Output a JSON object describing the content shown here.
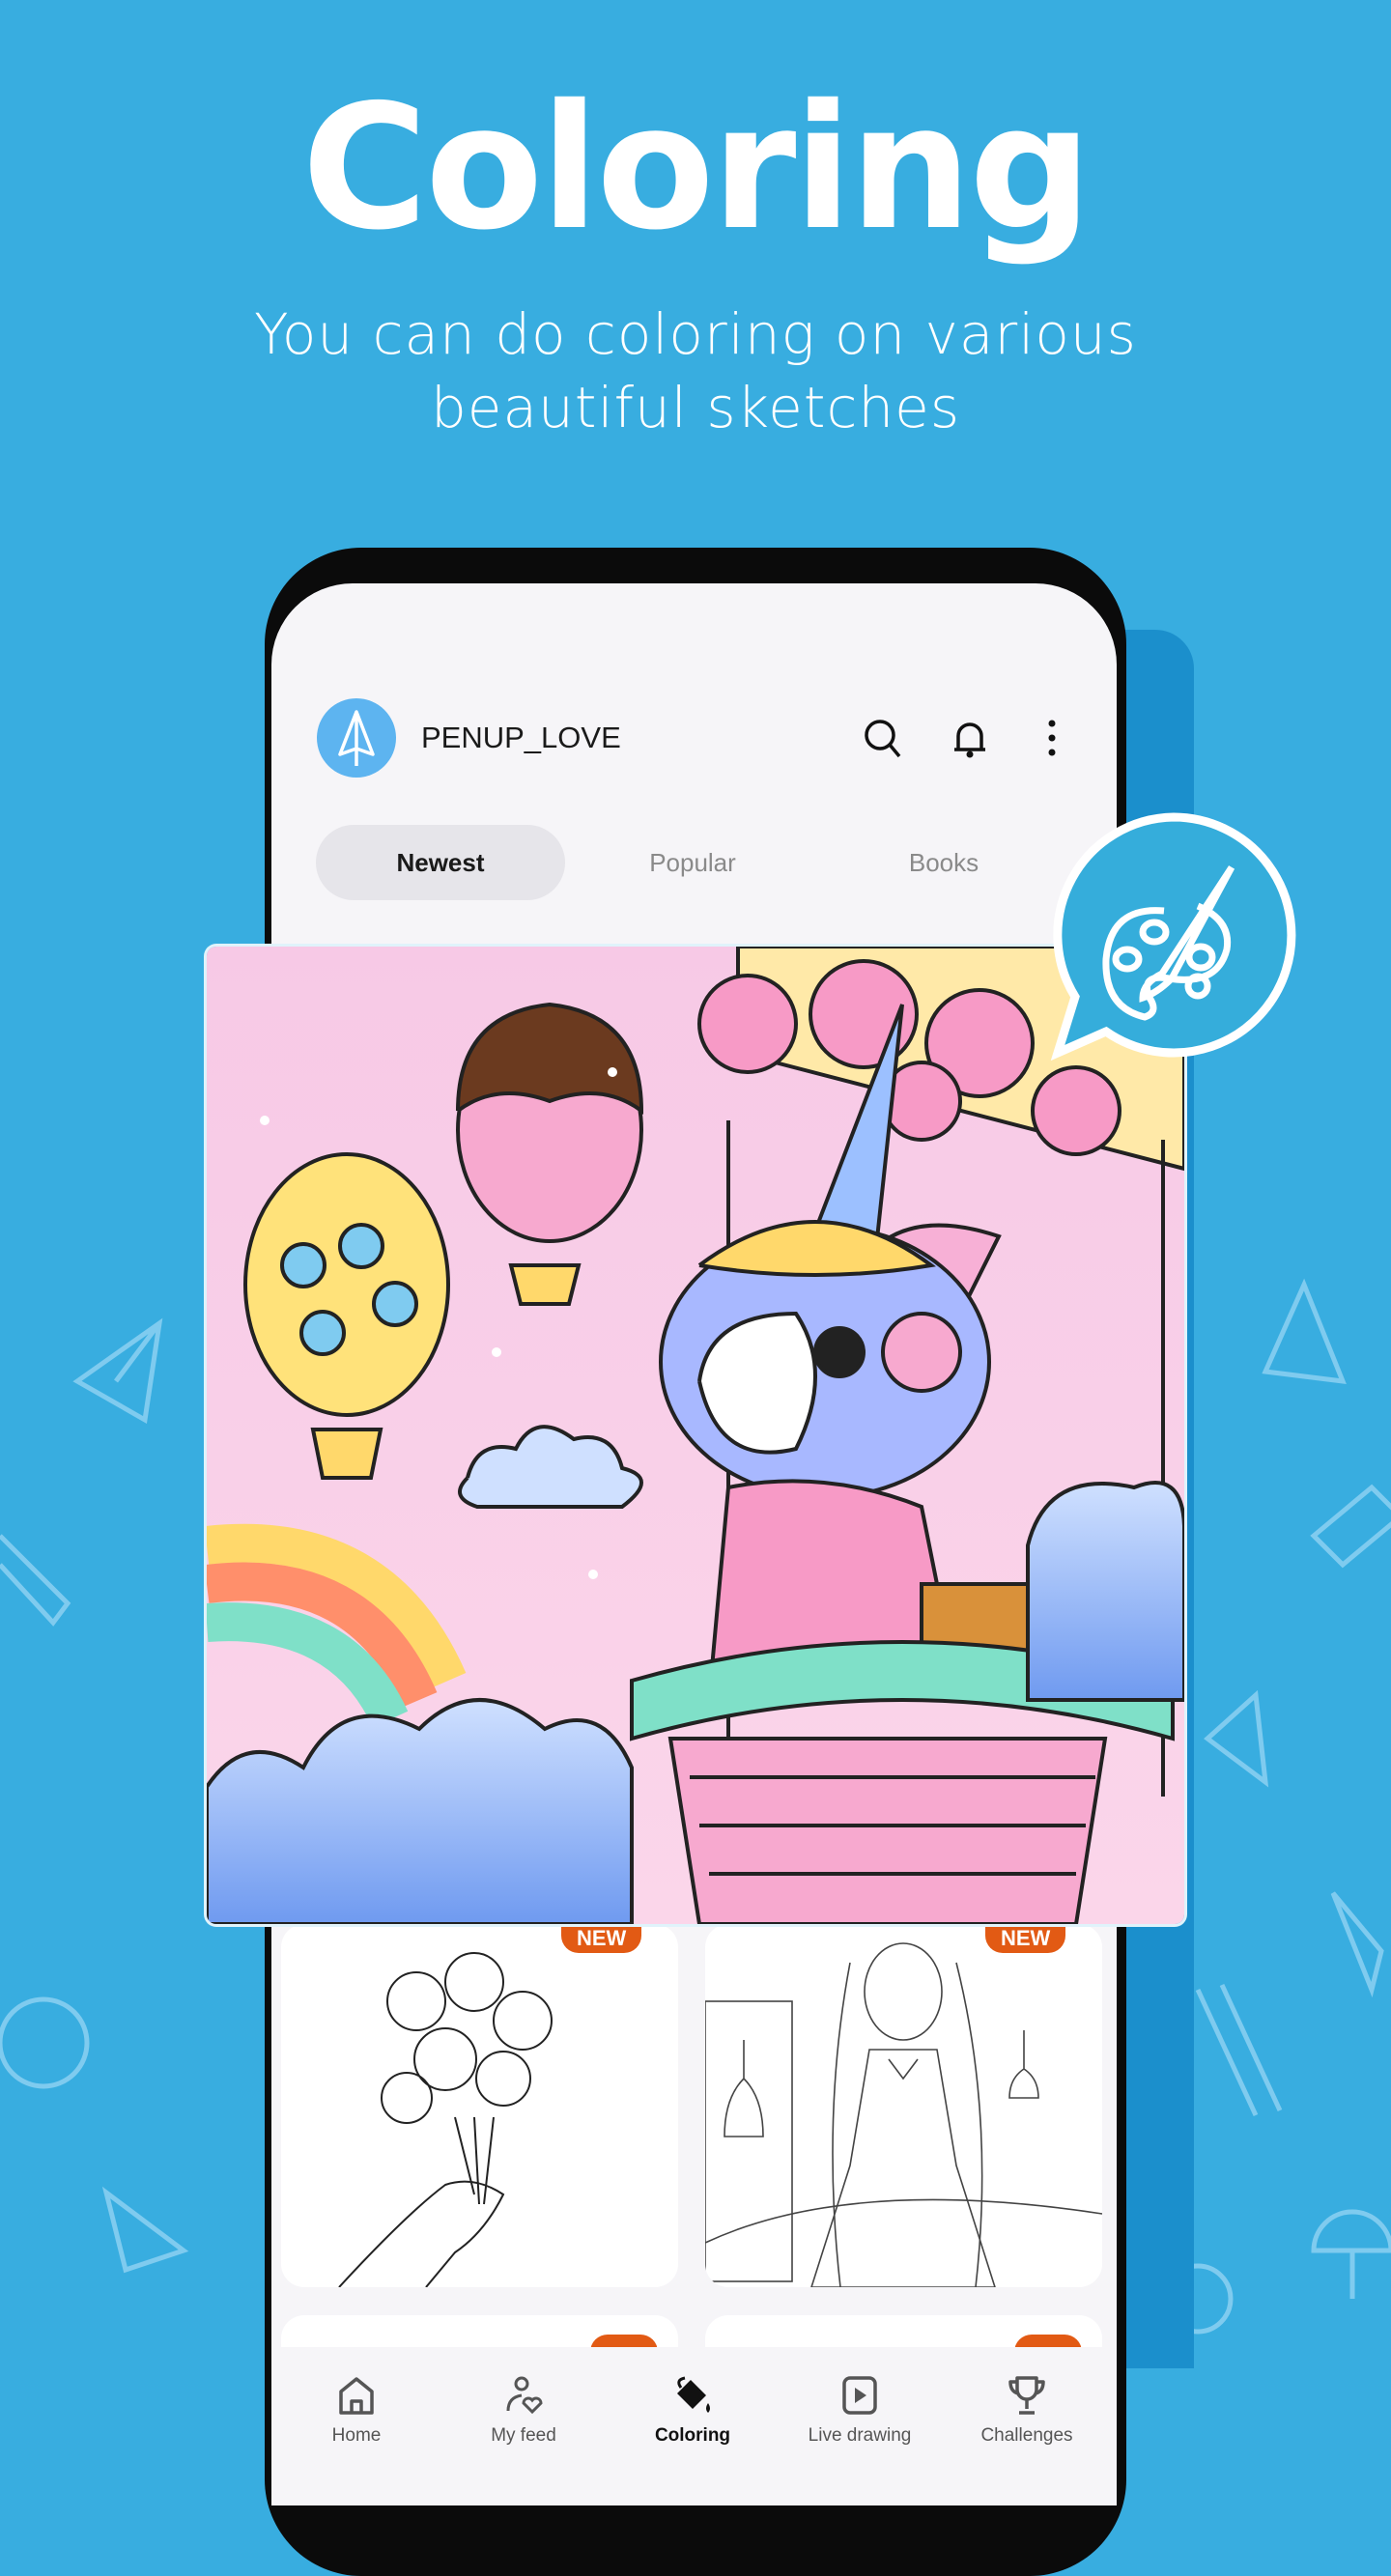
{
  "promo": {
    "title": "Coloring",
    "subtitle_line1": "You can do coloring on various",
    "subtitle_line2": "beautiful sketches"
  },
  "header": {
    "username": "PENUP_LOVE",
    "icons": [
      "search-icon",
      "bell-icon",
      "more-vert-icon"
    ]
  },
  "tabs": [
    {
      "label": "Newest",
      "selected": true
    },
    {
      "label": "Popular"
    },
    {
      "label": "Books"
    }
  ],
  "grid": [
    {
      "badge": "NEW",
      "subject": "flower bouquet sketch"
    },
    {
      "badge": "NEW",
      "subject": "girl with potion sketch"
    }
  ],
  "nav": [
    {
      "label": "Home",
      "icon": "home-icon"
    },
    {
      "label": "My feed",
      "icon": "feed-icon"
    },
    {
      "label": "Coloring",
      "icon": "paint-bucket-icon",
      "active": true
    },
    {
      "label": "Live drawing",
      "icon": "play-icon"
    },
    {
      "label": "Challenges",
      "icon": "trophy-icon"
    }
  ],
  "colors": {
    "background": "#38ade0",
    "accent": "#5db4f0",
    "badge": "#e25a14",
    "bubble": "#35addb"
  }
}
